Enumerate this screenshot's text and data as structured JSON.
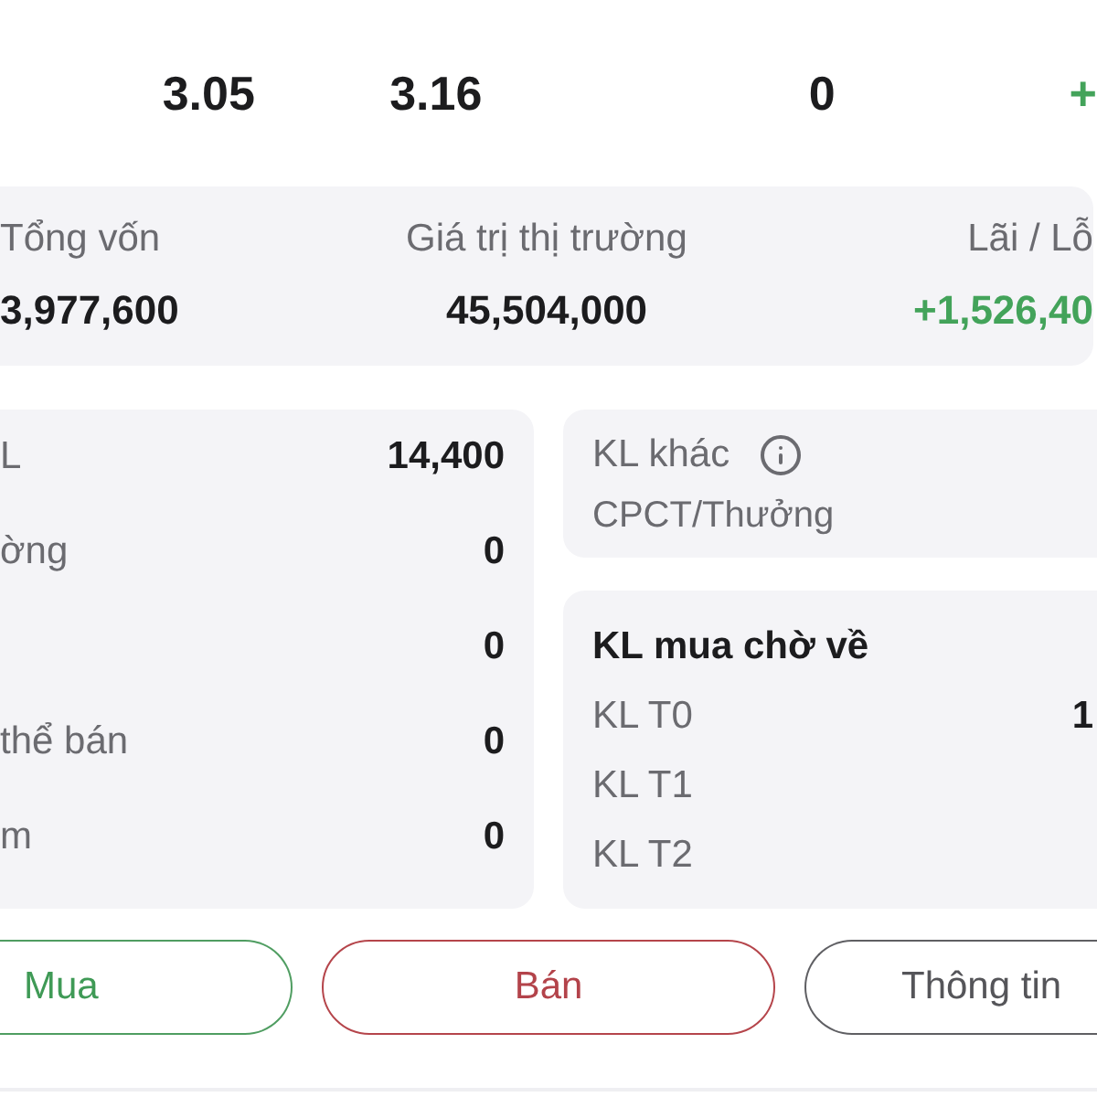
{
  "price_row": [
    {
      "text": "3.05",
      "color": "#1c1c1e"
    },
    {
      "text": "3.16",
      "color": "#1c1c1e"
    },
    {
      "text": "0",
      "color": "#1c1c1e"
    },
    {
      "text": "+",
      "color": "#43a35a"
    }
  ],
  "summary": [
    {
      "label": "Tổng vốn",
      "value": "3,977,600",
      "color": "#1c1c1e"
    },
    {
      "label": "Giá trị thị trường",
      "value": "45,504,000",
      "color": "#1c1c1e"
    },
    {
      "label": "Lãi / Lỗ",
      "value": "+1,526,40",
      "color": "#43a35a"
    }
  ],
  "holdings": [
    {
      "label": "L",
      "value": "14,400"
    },
    {
      "label": "ờng",
      "value": "0"
    },
    {
      "value": "0"
    },
    {
      "label": "thể bán",
      "value": "0"
    },
    {
      "label": "m",
      "value": "0"
    }
  ],
  "other_volume": {
    "title": "KL khác",
    "subtitle": "CPCT/Thưởng"
  },
  "pending_buy": {
    "title": "KL mua chờ về",
    "rows": [
      {
        "label": "KL T0",
        "value": "1"
      },
      {
        "label": "KL T1"
      },
      {
        "label": "KL T2"
      }
    ]
  },
  "actions": [
    {
      "label": "Mua",
      "kind": "buy"
    },
    {
      "label": "Bán",
      "kind": "sell"
    },
    {
      "label": "Thông tin",
      "kind": "info"
    }
  ]
}
